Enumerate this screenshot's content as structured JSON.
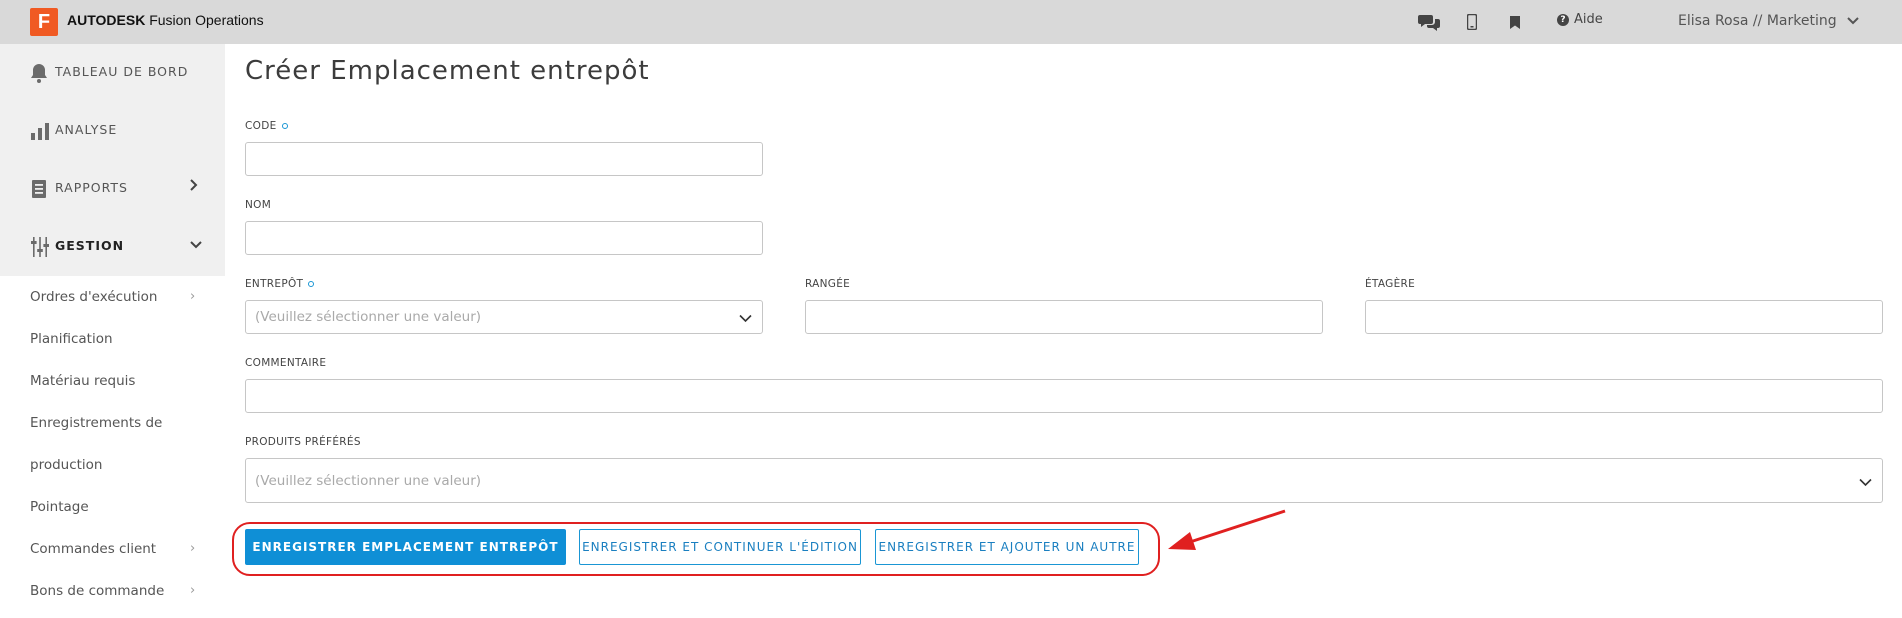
{
  "topbar": {
    "logo_letter": "F",
    "brand_bold": "AUTODESK",
    "brand_rest": " Fusion Operations",
    "icons": [
      "chat-icon",
      "mobile-icon",
      "bookmark-icon"
    ],
    "help_label": "Aide",
    "user_label": "Elisa Rosa // Marketing"
  },
  "sidebar": {
    "main_items": [
      {
        "label": "TABLEAU DE BORD",
        "icon": "bell-icon"
      },
      {
        "label": "ANALYSE",
        "icon": "bar-chart-icon"
      },
      {
        "label": "RAPPORTS",
        "icon": "report-icon",
        "chevron": "›"
      },
      {
        "label": "GESTION",
        "icon": "sliders-icon",
        "chevron": "⌄"
      }
    ],
    "sub_items": [
      {
        "label": "Ordres d'exécution",
        "chevron": "›"
      },
      {
        "label": "Planification"
      },
      {
        "label": "Matériau requis"
      },
      {
        "label": "Enregistrements de"
      },
      {
        "label": "production"
      },
      {
        "label": "Pointage"
      },
      {
        "label": "Commandes client",
        "chevron": "›"
      },
      {
        "label": "Bons de commande",
        "chevron": "›"
      }
    ]
  },
  "form": {
    "title": "Créer Emplacement entrepôt",
    "code_label": "CODE",
    "nom_label": "NOM",
    "entrepot_label": "ENTREPÔT",
    "entrepot_placeholder": "(Veuillez sélectionner une valeur)",
    "rangee_label": "RANGÉE",
    "etagere_label": "ÉTAGÈRE",
    "commentaire_label": "COMMENTAIRE",
    "produits_label": "PRODUITS PRÉFÉRÉS",
    "produits_placeholder": "(Veuillez sélectionner une valeur)"
  },
  "actions": {
    "save": "ENREGISTRER EMPLACEMENT ENTREPÔT",
    "save_continue": "ENREGISTRER ET CONTINUER L'ÉDITION",
    "save_add": "ENREGISTRER ET AJOUTER UN AUTRE"
  },
  "colors": {
    "accent": "#0f8fd6",
    "annotation": "#e02020",
    "logo": "#f05a23"
  }
}
